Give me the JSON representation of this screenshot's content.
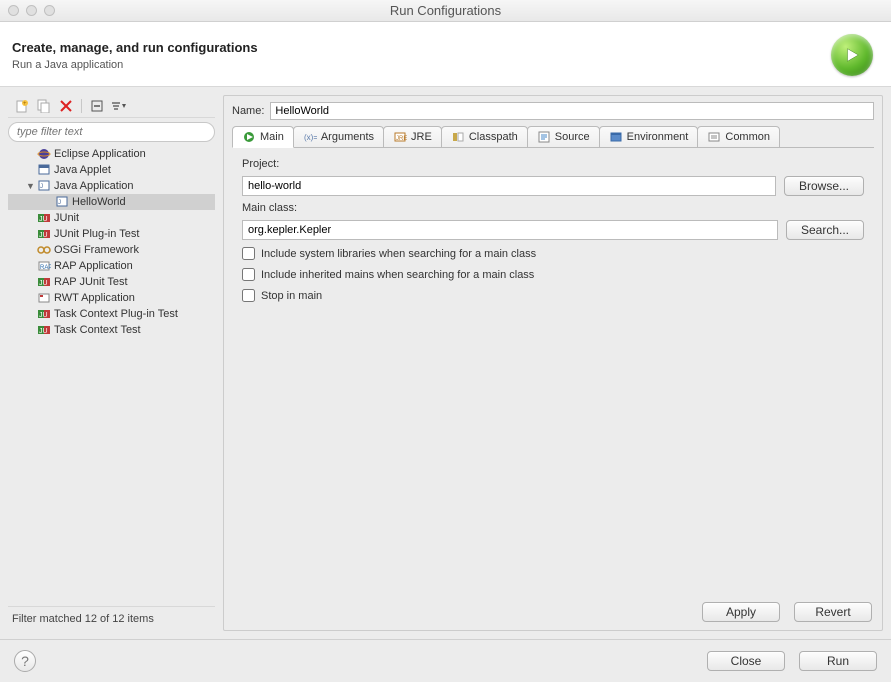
{
  "window": {
    "title": "Run Configurations"
  },
  "header": {
    "title": "Create, manage, and run configurations",
    "subtitle": "Run a Java application"
  },
  "filter": {
    "placeholder": "type filter text"
  },
  "tree": [
    {
      "label": "Eclipse Application",
      "icon": "eclipse"
    },
    {
      "label": "Java Applet",
      "icon": "applet"
    },
    {
      "label": "Java Application",
      "icon": "java",
      "expanded": true,
      "children": [
        {
          "label": "HelloWorld",
          "icon": "java",
          "selected": true
        }
      ]
    },
    {
      "label": "JUnit",
      "icon": "junit"
    },
    {
      "label": "JUnit Plug-in Test",
      "icon": "junit"
    },
    {
      "label": "OSGi Framework",
      "icon": "osgi"
    },
    {
      "label": "RAP Application",
      "icon": "rap"
    },
    {
      "label": "RAP JUnit Test",
      "icon": "junit"
    },
    {
      "label": "RWT Application",
      "icon": "rwt"
    },
    {
      "label": "Task Context Plug-in Test",
      "icon": "junit"
    },
    {
      "label": "Task Context Test",
      "icon": "junit"
    }
  ],
  "filter_status": "Filter matched 12 of 12 items",
  "name_field": {
    "label": "Name:",
    "value": "HelloWorld"
  },
  "tabs": [
    {
      "label": "Main",
      "icon": "main",
      "active": true
    },
    {
      "label": "Arguments",
      "icon": "args"
    },
    {
      "label": "JRE",
      "icon": "jre"
    },
    {
      "label": "Classpath",
      "icon": "classpath"
    },
    {
      "label": "Source",
      "icon": "source"
    },
    {
      "label": "Environment",
      "icon": "env"
    },
    {
      "label": "Common",
      "icon": "common"
    }
  ],
  "main_tab": {
    "project_label": "Project:",
    "project_value": "hello-world",
    "browse_label": "Browse...",
    "mainclass_label": "Main class:",
    "mainclass_value": "org.kepler.Kepler",
    "search_label": "Search...",
    "include_syslib_label": "Include system libraries when searching for a main class",
    "include_inherited_label": "Include inherited mains when searching for a main class",
    "stop_in_main_label": "Stop in main"
  },
  "buttons": {
    "apply": "Apply",
    "revert": "Revert",
    "close": "Close",
    "run": "Run"
  }
}
